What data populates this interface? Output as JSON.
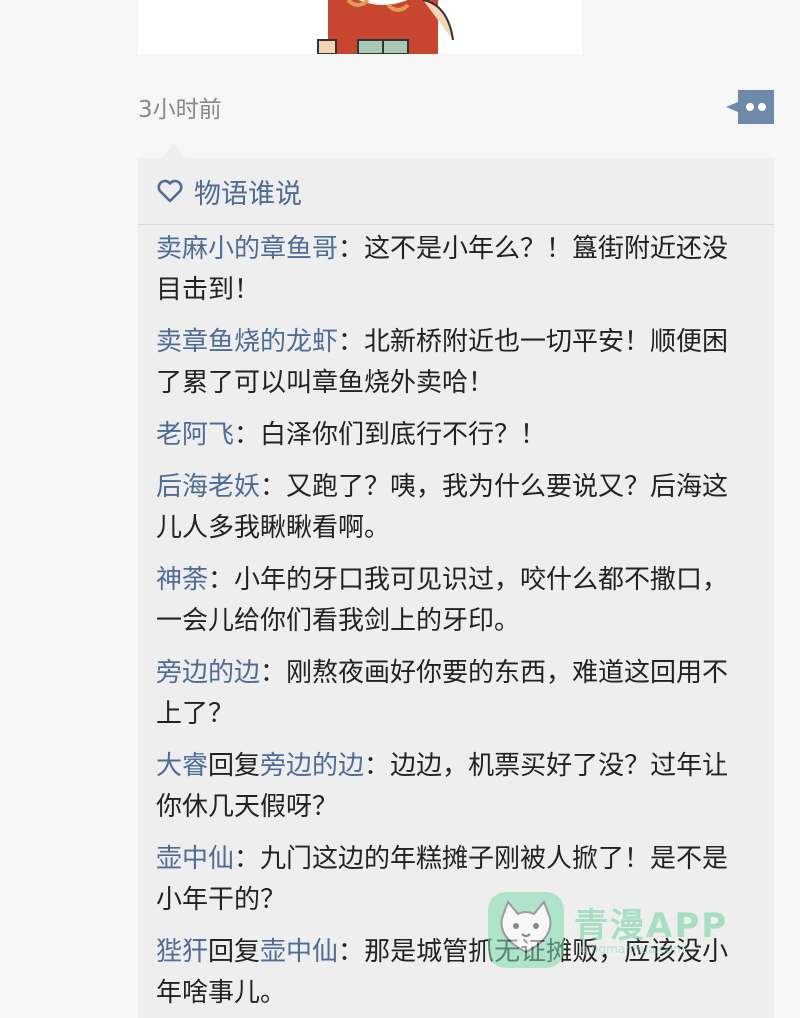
{
  "post": {
    "timestamp": "3小时前"
  },
  "comments_card": {
    "title": "物语谁说",
    "items": [
      {
        "name": "卖麻小的章鱼哥",
        "reply_label": "",
        "reply_to": "",
        "sep": "：",
        "text": "这不是小年么？！簋街附近还没目击到！"
      },
      {
        "name": "卖章鱼烧的龙虾",
        "reply_label": "",
        "reply_to": "",
        "sep": "：",
        "text": "北新桥附近也一切平安！顺便困了累了可以叫章鱼烧外卖哈！"
      },
      {
        "name": "老阿飞",
        "reply_label": "",
        "reply_to": "",
        "sep": "：",
        "text": "白泽你们到底行不行？！"
      },
      {
        "name": "后海老妖",
        "reply_label": "",
        "reply_to": "",
        "sep": "：",
        "text": "又跑了？咦，我为什么要说又？后海这儿人多我瞅瞅看啊。"
      },
      {
        "name": "神荼",
        "reply_label": "",
        "reply_to": "",
        "sep": "：",
        "text": "小年的牙口我可见识过，咬什么都不撒口，一会儿给你们看我剑上的牙印。"
      },
      {
        "name": "旁边的边",
        "reply_label": "",
        "reply_to": "",
        "sep": "：",
        "text": "刚熬夜画好你要的东西，难道这回用不上了？"
      },
      {
        "name": "大睿",
        "reply_label": "回复",
        "reply_to": "旁边的边",
        "sep": "：",
        "text": "边边，机票买好了没？过年让你休几天假呀？"
      },
      {
        "name": "壶中仙",
        "reply_label": "",
        "reply_to": "",
        "sep": "：",
        "text": "九门这边的年糕摊子刚被人掀了！是不是小年干的？"
      },
      {
        "name": "狴犴",
        "reply_label": "回复",
        "reply_to": "壶中仙",
        "sep": "：",
        "text": "那是城管抓无证摊贩，应该没小年啥事儿。"
      }
    ]
  },
  "watermark": {
    "brand": "青漫APP",
    "sub": "qingmanhua.com"
  },
  "colors": {
    "name_link": "#4f6c94",
    "card_bg": "#eeeeee",
    "page_bg": "#f6f6f6"
  }
}
